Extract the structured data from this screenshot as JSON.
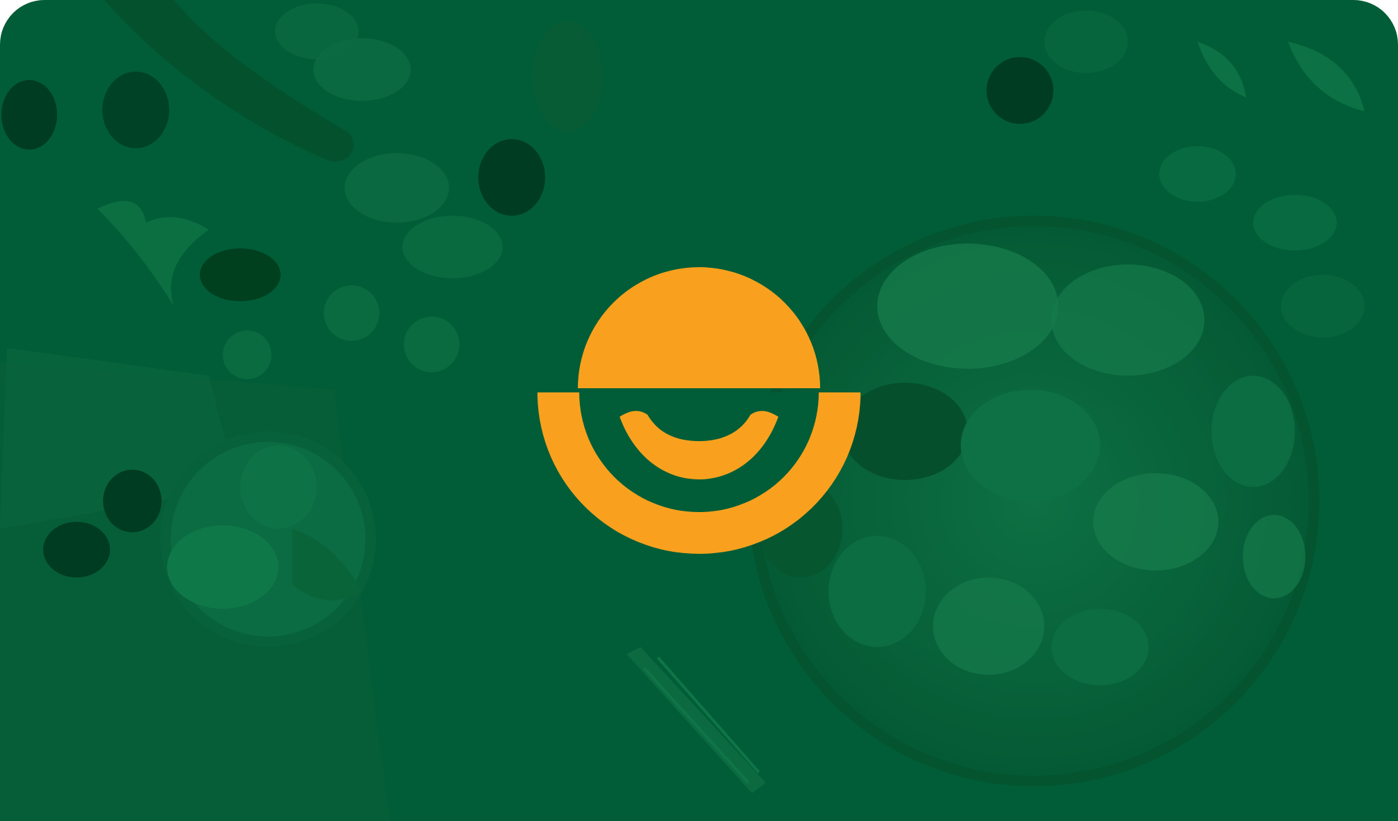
{
  "banner": {
    "background_color": "#015d37",
    "overlay_tint_dark": "#00522f",
    "overlay_tint_light": "#0a6a40",
    "logo": {
      "icon": "smiling-bowl-logo-icon",
      "color": "#f9a11e"
    },
    "background_image": "salad-bowl-with-vegetables-photo"
  }
}
